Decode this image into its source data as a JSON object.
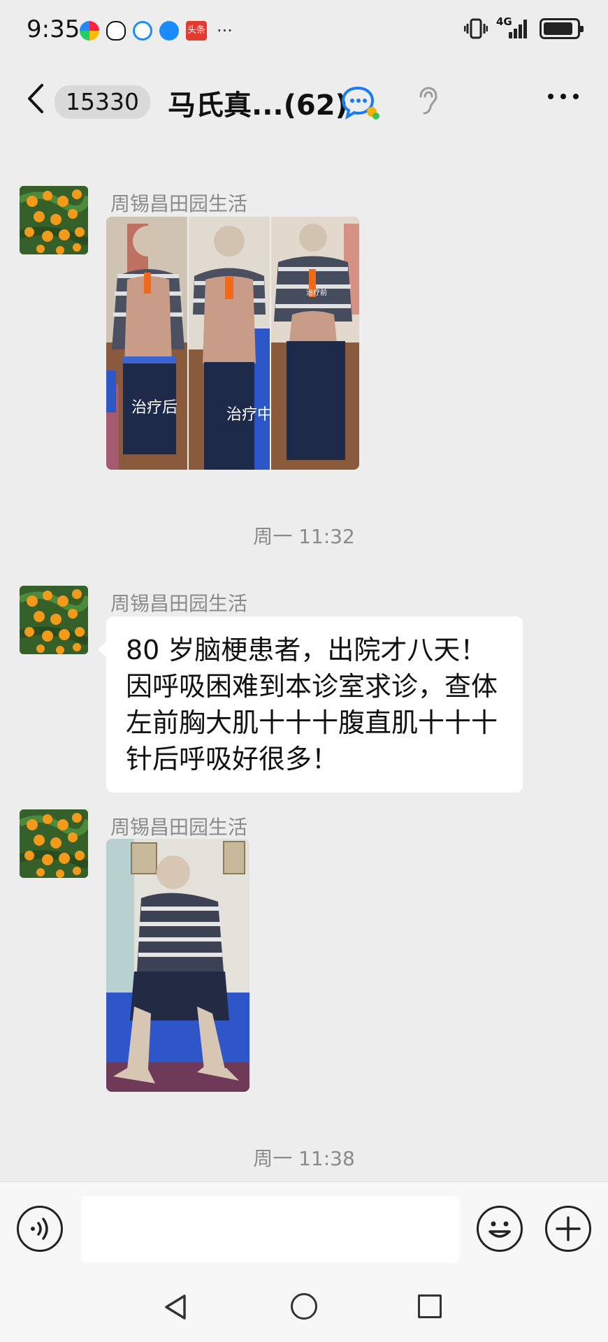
{
  "status_bar": {
    "time": "9:35",
    "notification_icons": [
      "colorful-app-icon",
      "qq-penguin-icon",
      "chat-bubble-icon",
      "blue-bubble-icon",
      "toutiao-icon"
    ],
    "news_badge": "头条",
    "more": "···",
    "network": "4G",
    "battery_level": 0.9
  },
  "header": {
    "unread_count": "15330",
    "title": "马氏真...(62)"
  },
  "messages": [
    {
      "sender": "周锡昌田园生活",
      "type": "image",
      "image_labels": [
        "治疗后",
        "治疗中",
        "治疗前"
      ]
    },
    {
      "timestamp": "周一 11:32"
    },
    {
      "sender": "周锡昌田园生活",
      "type": "text",
      "text": "80 岁脑梗患者，出院才八天！因呼吸困难到本诊室求诊，查体左前胸大肌十十十腹直肌十十十针后呼吸好很多！"
    },
    {
      "sender": "周锡昌田园生活",
      "type": "image"
    },
    {
      "timestamp": "周一 11:38"
    }
  ],
  "input": {
    "placeholder": ""
  },
  "colors": {
    "background": "#ededed",
    "bubble": "#ffffff",
    "secondary_text": "#8a8a8a",
    "bed_blue": "#2f56c8"
  }
}
